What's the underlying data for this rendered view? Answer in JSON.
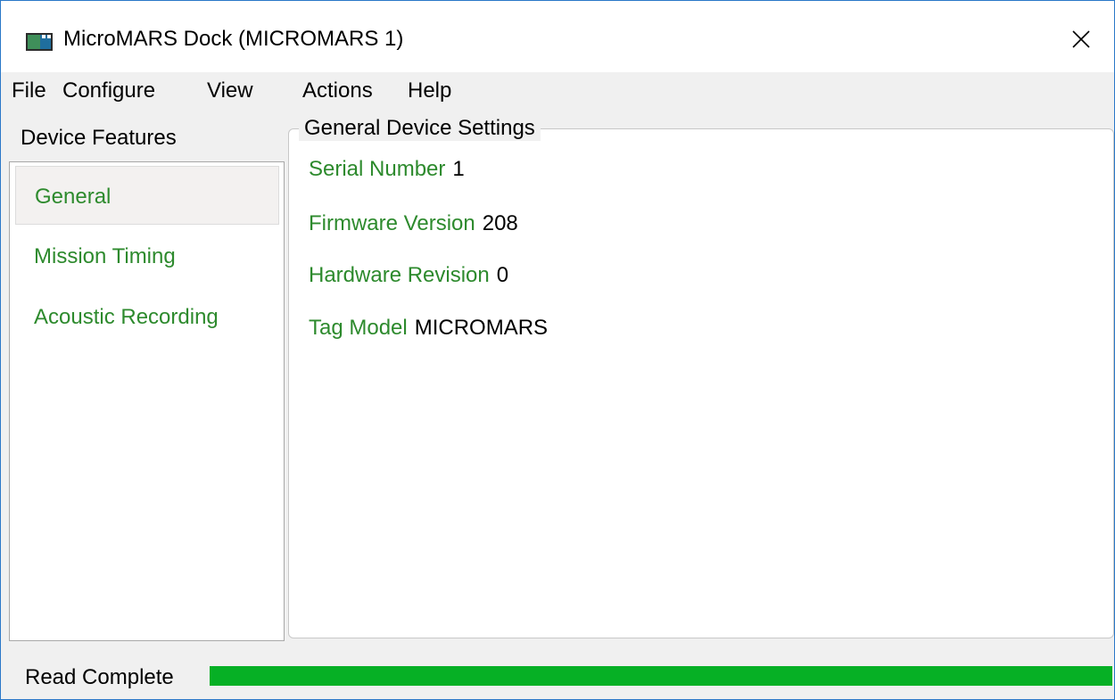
{
  "window": {
    "title": "MicroMARS Dock (MICROMARS 1)",
    "icon": "app-window-icon",
    "close_icon": "close-icon"
  },
  "menu": {
    "items": [
      "File",
      "Configure",
      "View",
      "Actions",
      "Help"
    ]
  },
  "sidebar": {
    "heading": "Device Features",
    "items": [
      {
        "label": "General",
        "selected": true
      },
      {
        "label": "Mission Timing",
        "selected": false
      },
      {
        "label": "Acoustic Recording",
        "selected": false
      }
    ]
  },
  "main": {
    "group_title": "General Device Settings",
    "fields": [
      {
        "label": "Serial Number",
        "value": "1"
      },
      {
        "label": "Firmware Version",
        "value": "208"
      },
      {
        "label": "Hardware Revision",
        "value": "0"
      },
      {
        "label": "Tag Model",
        "value": "MICROMARS"
      }
    ]
  },
  "status": {
    "text": "Read Complete",
    "progress": 1.0
  },
  "colors": {
    "label_green": "#2d8a2d",
    "progress_green": "#06b025",
    "window_border": "#2a78c8"
  }
}
